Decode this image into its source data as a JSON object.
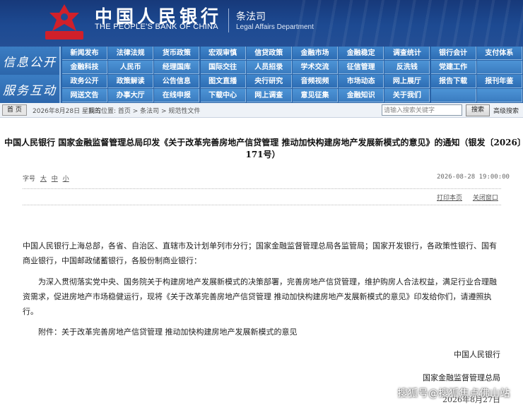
{
  "header": {
    "bank_name_cn": "中国人民银行",
    "bank_name_en": "THE PEOPLE'S BANK OF CHINA",
    "dept_cn": "条法司",
    "dept_en": "Legal Affairs Department"
  },
  "nav": {
    "section1": "信息公开",
    "section2": "服务互动",
    "row1": [
      "新闻发布",
      "法律法规",
      "货币政策",
      "宏观审慎",
      "信贷政策",
      "金融市场",
      "金融稳定",
      "调查统计",
      "银行会计",
      "支付体系"
    ],
    "row2": [
      "金融科技",
      "人民币",
      "经理国库",
      "国际交往",
      "人员招录",
      "学术交流",
      "征信管理",
      "反洗钱",
      "党建工作",
      ""
    ],
    "row3": [
      "政务公开",
      "政策解读",
      "公告信息",
      "图文直播",
      "央行研究",
      "音频视频",
      "市场动态",
      "网上展厅",
      "报告下载",
      "报刊年鉴"
    ],
    "row4": [
      "网送文告",
      "办事大厅",
      "在线申报",
      "下载中心",
      "网上调查",
      "意见征集",
      "金融知识",
      "关于我们",
      "",
      ""
    ]
  },
  "crumb": {
    "home": "首 页",
    "date": "2026年8月28日 星期五",
    "position": "我的位置: 首页  >  条法司  >  规范性文件",
    "search_placeholder": "请输入搜索关键字",
    "search_button": "搜索",
    "advanced": "高级搜索"
  },
  "article": {
    "title": "中国人民银行 国家金融监督管理总局印发《关于改革完善房地产信贷管理 推动加快构建房地产发展新模式的意见》的通知（银发〔2026〕171号）",
    "font_label": "字号",
    "font_large": "大",
    "font_mid": "中",
    "font_small": "小",
    "timestamp": "2026-08-28 19:00:00",
    "print": "打印本页",
    "close": "关闭窗口",
    "p1": "中国人民银行上海总部，各省、自治区、直辖市及计划单列市分行；国家金融监督管理总局各监管局；国家开发银行，各政策性银行、国有商业银行，中国邮政储蓄银行，各股份制商业银行：",
    "p2": "为深入贯彻落实党中央、国务院关于构建房地产发展新模式的决策部署，完善房地产信贷管理，维护购房人合法权益，满足行业合理融资需求，促进房地产市场稳健运行，现将《关于改革完善房地产信贷管理 推动加快构建房地产发展新模式的意见》印发给你们，请遵照执行。",
    "p3": "附件：关于改革完善房地产信贷管理 推动加快构建房地产发展新模式的意见",
    "sign1": "中国人民银行",
    "sign2": "国家金融监督管理总局",
    "sign_date": "2026年8月27日"
  },
  "watermark": "搜狐号@搜狐焦点佛山站",
  "colors": {
    "header_bg": "#1d4a92",
    "nav_bg": "#2a63a6",
    "emblem": "#d0202a"
  }
}
